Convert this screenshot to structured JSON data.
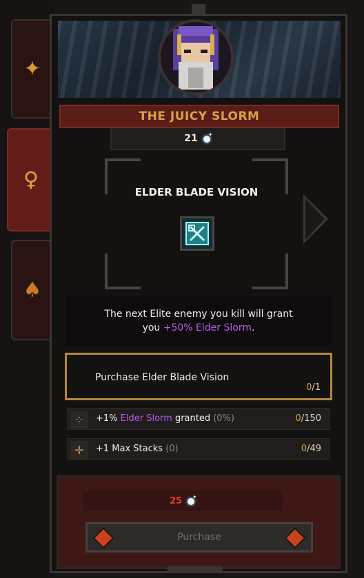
{
  "tabs": [
    {
      "icon": "flame-star-icon",
      "glyph": "✦",
      "color": "#d99a2b"
    },
    {
      "icon": "orb-target-icon",
      "glyph": "♀",
      "color": "#e3a43d"
    },
    {
      "icon": "flame-icon",
      "glyph": "♠",
      "color": "#c87a28"
    }
  ],
  "character": {
    "title": "THE JUICY SLORM",
    "currency": "21"
  },
  "upgrade": {
    "name": "ELDER BLADE VISION",
    "description_before": "The next Elite enemy you kill will grant you ",
    "description_highlight": "+50% Elder Slorm",
    "description_after": "."
  },
  "purchase_row": {
    "label": "Purchase Elder Blade Vision",
    "current": "0",
    "max": "/1"
  },
  "stats": [
    {
      "icon": "scatter-icon",
      "prefix": "+1% ",
      "highlight": "Elder Slorm",
      "suffix": " granted ",
      "muted": "(0%)",
      "current": "0",
      "max": "/150"
    },
    {
      "icon": "cross-icon",
      "prefix": "+1 Max Stacks ",
      "highlight": "",
      "suffix": "",
      "muted": "(0)",
      "current": "0",
      "max": "/49"
    }
  ],
  "footer": {
    "cost": "25",
    "button_label": "Purchase"
  },
  "colors": {
    "accent_gold": "#b18a3b",
    "highlight_purple": "#b45ce8",
    "title_red": "#5a1d18",
    "cost_red": "#e23b2b"
  }
}
